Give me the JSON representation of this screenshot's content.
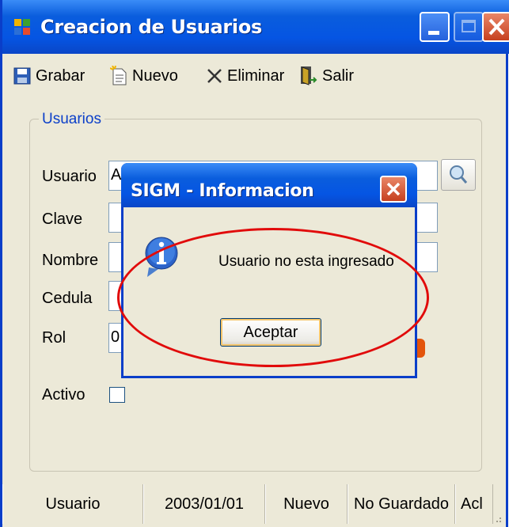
{
  "window": {
    "title": "Creacion de Usuarios"
  },
  "toolbar": {
    "grabar": "Grabar",
    "nuevo": "Nuevo",
    "eliminar": "Eliminar",
    "salir": "Salir"
  },
  "form": {
    "group_title": "Usuarios",
    "usuario_label": "Usuario",
    "usuario_value": "A",
    "clave_label": "Clave",
    "nombre_label": "Nombre",
    "cedula_label": "Cedula",
    "rol_label": "Rol",
    "rol_value": "0",
    "activo_label": "Activo"
  },
  "statusbar": {
    "usuario": "Usuario",
    "fecha": "2003/01/01",
    "modo": "Nuevo",
    "estado": "No Guardado",
    "extra": "Acl"
  },
  "dialog": {
    "title": "SIGM - Informacion",
    "message": "Usuario no esta ingresado",
    "ok_label": "Aceptar",
    "icon": "info-icon"
  },
  "colors": {
    "titlebar": "#0555e3",
    "close": "#c6401f",
    "highlight_ellipse": "#e10b0b"
  }
}
